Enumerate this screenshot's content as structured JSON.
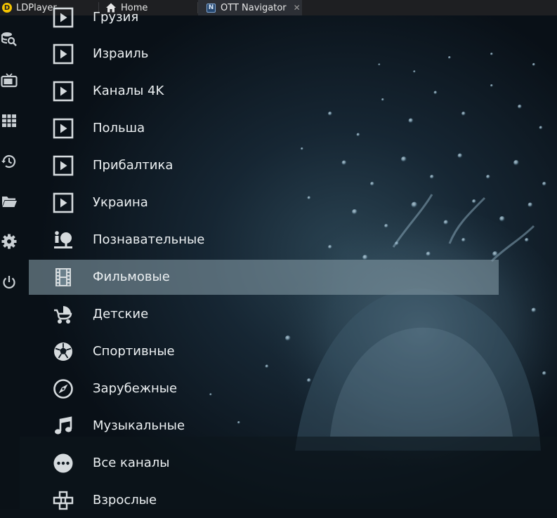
{
  "tabs": [
    {
      "label": "LDPlayer",
      "icon": "ldplayer-logo-icon"
    },
    {
      "label": "Home",
      "icon": "home-icon"
    },
    {
      "label": "OTT Navigator",
      "icon": "ott-navigator-logo-icon",
      "active": true
    }
  ],
  "rail": [
    "search-icon",
    "tv-icon",
    "grid-icon",
    "history-icon",
    "folder-icon",
    "settings-icon",
    "power-icon"
  ],
  "menu": {
    "items": [
      {
        "label": "Грузия",
        "icon": "play-icon"
      },
      {
        "label": "Израиль",
        "icon": "play-icon"
      },
      {
        "label": "Каналы 4K",
        "icon": "play-icon"
      },
      {
        "label": "Польша",
        "icon": "play-icon"
      },
      {
        "label": "Прибалтика",
        "icon": "play-icon"
      },
      {
        "label": "Украина",
        "icon": "play-icon"
      },
      {
        "label": "Познавательные",
        "icon": "education-icon"
      },
      {
        "label": "Фильмовые",
        "icon": "film-icon",
        "selected": true
      },
      {
        "label": "Детские",
        "icon": "stroller-icon"
      },
      {
        "label": "Спортивные",
        "icon": "soccer-ball-icon"
      },
      {
        "label": "Зарубежные",
        "icon": "compass-icon"
      },
      {
        "label": "Музыкальные",
        "icon": "music-note-icon"
      },
      {
        "label": "Все каналы",
        "icon": "more-dots-icon"
      },
      {
        "label": "Взрослые",
        "icon": "blocks-icon"
      }
    ]
  },
  "colors": {
    "selected_row": "#7e94a0",
    "text": "#ecf0f2",
    "icon": "#d6dbde",
    "background": "#0b1218"
  }
}
